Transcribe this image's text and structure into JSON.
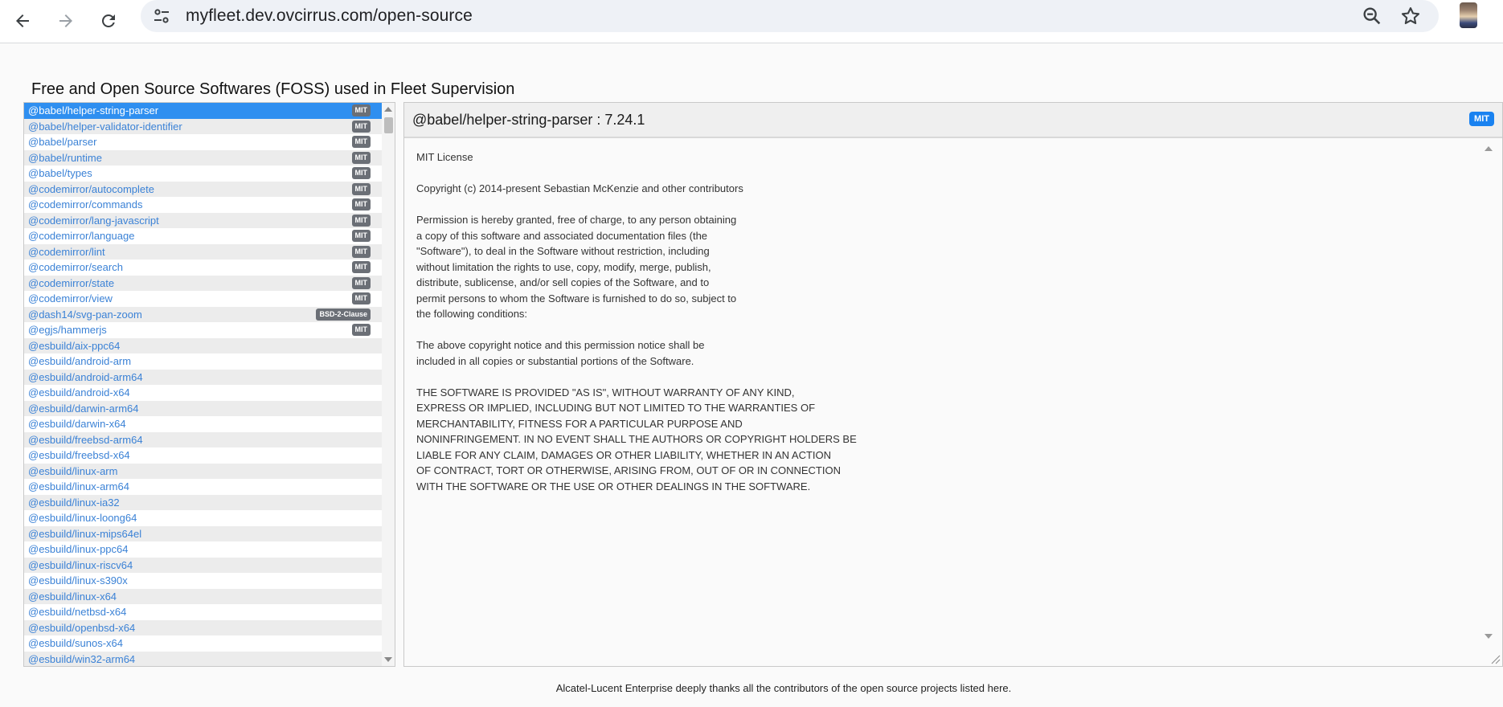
{
  "browser": {
    "url": "myfleet.dev.ovcirrus.com/open-source"
  },
  "page": {
    "title": "Free and Open Source Softwares (FOSS) used in Fleet Supervision",
    "footer": "Alcatel-Lucent Enterprise deeply thanks all the contributors of the open source projects listed here."
  },
  "packages": [
    {
      "name": "@babel/helper-string-parser",
      "license": "MIT",
      "selected": true
    },
    {
      "name": "@babel/helper-validator-identifier",
      "license": "MIT"
    },
    {
      "name": "@babel/parser",
      "license": "MIT"
    },
    {
      "name": "@babel/runtime",
      "license": "MIT"
    },
    {
      "name": "@babel/types",
      "license": "MIT"
    },
    {
      "name": "@codemirror/autocomplete",
      "license": "MIT"
    },
    {
      "name": "@codemirror/commands",
      "license": "MIT"
    },
    {
      "name": "@codemirror/lang-javascript",
      "license": "MIT"
    },
    {
      "name": "@codemirror/language",
      "license": "MIT"
    },
    {
      "name": "@codemirror/lint",
      "license": "MIT"
    },
    {
      "name": "@codemirror/search",
      "license": "MIT"
    },
    {
      "name": "@codemirror/state",
      "license": "MIT"
    },
    {
      "name": "@codemirror/view",
      "license": "MIT"
    },
    {
      "name": "@dash14/svg-pan-zoom",
      "license": "BSD-2-Clause"
    },
    {
      "name": "@egjs/hammerjs",
      "license": "MIT"
    },
    {
      "name": "@esbuild/aix-ppc64",
      "license": ""
    },
    {
      "name": "@esbuild/android-arm",
      "license": ""
    },
    {
      "name": "@esbuild/android-arm64",
      "license": ""
    },
    {
      "name": "@esbuild/android-x64",
      "license": ""
    },
    {
      "name": "@esbuild/darwin-arm64",
      "license": ""
    },
    {
      "name": "@esbuild/darwin-x64",
      "license": ""
    },
    {
      "name": "@esbuild/freebsd-arm64",
      "license": ""
    },
    {
      "name": "@esbuild/freebsd-x64",
      "license": ""
    },
    {
      "name": "@esbuild/linux-arm",
      "license": ""
    },
    {
      "name": "@esbuild/linux-arm64",
      "license": ""
    },
    {
      "name": "@esbuild/linux-ia32",
      "license": ""
    },
    {
      "name": "@esbuild/linux-loong64",
      "license": ""
    },
    {
      "name": "@esbuild/linux-mips64el",
      "license": ""
    },
    {
      "name": "@esbuild/linux-ppc64",
      "license": ""
    },
    {
      "name": "@esbuild/linux-riscv64",
      "license": ""
    },
    {
      "name": "@esbuild/linux-s390x",
      "license": ""
    },
    {
      "name": "@esbuild/linux-x64",
      "license": ""
    },
    {
      "name": "@esbuild/netbsd-x64",
      "license": ""
    },
    {
      "name": "@esbuild/openbsd-x64",
      "license": ""
    },
    {
      "name": "@esbuild/sunos-x64",
      "license": ""
    },
    {
      "name": "@esbuild/win32-arm64",
      "license": ""
    }
  ],
  "detail": {
    "title": "@babel/helper-string-parser : 7.24.1",
    "license_badge": "MIT",
    "license_text": "MIT License\n\nCopyright (c) 2014-present Sebastian McKenzie and other contributors\n\nPermission is hereby granted, free of charge, to any person obtaining\na copy of this software and associated documentation files (the\n\"Software\"), to deal in the Software without restriction, including\nwithout limitation the rights to use, copy, modify, merge, publish,\ndistribute, sublicense, and/or sell copies of the Software, and to\npermit persons to whom the Software is furnished to do so, subject to\nthe following conditions:\n\nThe above copyright notice and this permission notice shall be\nincluded in all copies or substantial portions of the Software.\n\nTHE SOFTWARE IS PROVIDED \"AS IS\", WITHOUT WARRANTY OF ANY KIND,\nEXPRESS OR IMPLIED, INCLUDING BUT NOT LIMITED TO THE WARRANTIES OF\nMERCHANTABILITY, FITNESS FOR A PARTICULAR PURPOSE AND\nNONINFRINGEMENT. IN NO EVENT SHALL THE AUTHORS OR COPYRIGHT HOLDERS BE\nLIABLE FOR ANY CLAIM, DAMAGES OR OTHER LIABILITY, WHETHER IN AN ACTION\nOF CONTRACT, TORT OR OTHERWISE, ARISING FROM, OUT OF OR IN CONNECTION\nWITH THE SOFTWARE OR THE USE OR OTHER DEALINGS IN THE SOFTWARE."
  },
  "icons": {
    "back": "arrow-back-icon",
    "forward": "arrow-forward-icon",
    "reload": "reload-icon",
    "site_info": "tune-icon",
    "zoom": "zoom-out-icon",
    "bookmark": "star-icon"
  },
  "colors": {
    "link": "#3b82d6",
    "selected_row": "#2f8ff0",
    "badge": "#6b6f76",
    "license_badge": "#1a82f0"
  }
}
